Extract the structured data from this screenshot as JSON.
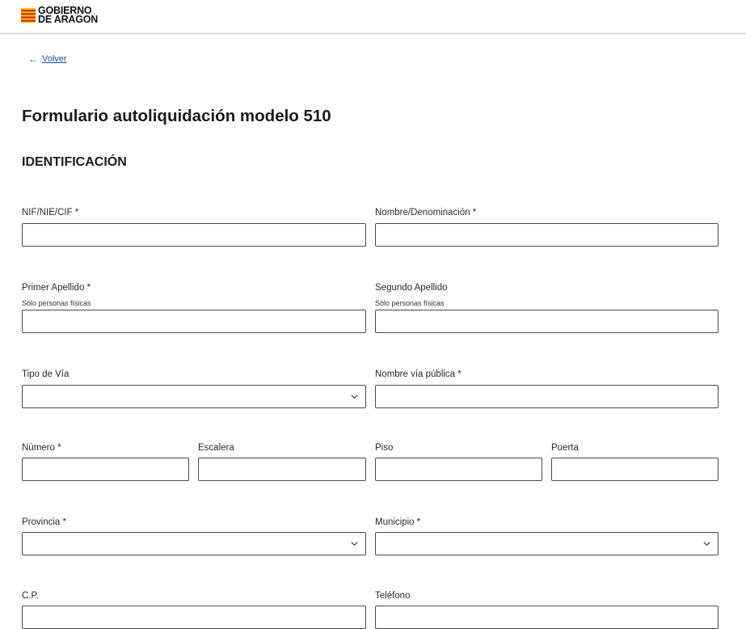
{
  "header": {
    "logo_line1": "GOBIERNO",
    "logo_line2": "DE ARAGON",
    "flag_colors": [
      "#f5c400",
      "#d52b1e"
    ]
  },
  "nav": {
    "back_label": "Volver",
    "back_icon": "arrow-left-icon"
  },
  "page": {
    "title": "Formulario autoliquidación modelo 510",
    "section": "IDENTIFICACIÓN"
  },
  "form": {
    "nif": {
      "label": "NIF/NIE/CIF *",
      "value": ""
    },
    "nombre": {
      "label": "Nombre/Denominación *",
      "value": ""
    },
    "apellido1": {
      "label": "Primer Apellido *",
      "hint": "Sólo personas físicas",
      "value": ""
    },
    "apellido2": {
      "label": "Segundo Apellido",
      "hint": "Sólo personas físicas",
      "value": ""
    },
    "tipo_via": {
      "label": "Tipo de Vía",
      "selected": ""
    },
    "nombre_via": {
      "label": "Nombre vía pública *",
      "value": ""
    },
    "numero": {
      "label": "Número *",
      "value": ""
    },
    "escalera": {
      "label": "Escalera",
      "value": ""
    },
    "piso": {
      "label": "Piso",
      "value": ""
    },
    "puerta": {
      "label": "Puerta",
      "value": ""
    },
    "provincia": {
      "label": "Provincia *",
      "selected": ""
    },
    "municipio": {
      "label": "Municipio *",
      "selected": ""
    },
    "cp": {
      "label": "C.P.",
      "value": ""
    },
    "telefono": {
      "label": "Teléfono",
      "value": ""
    }
  },
  "colors": {
    "link": "#1a4f9c",
    "border": "#4a4a4a"
  }
}
